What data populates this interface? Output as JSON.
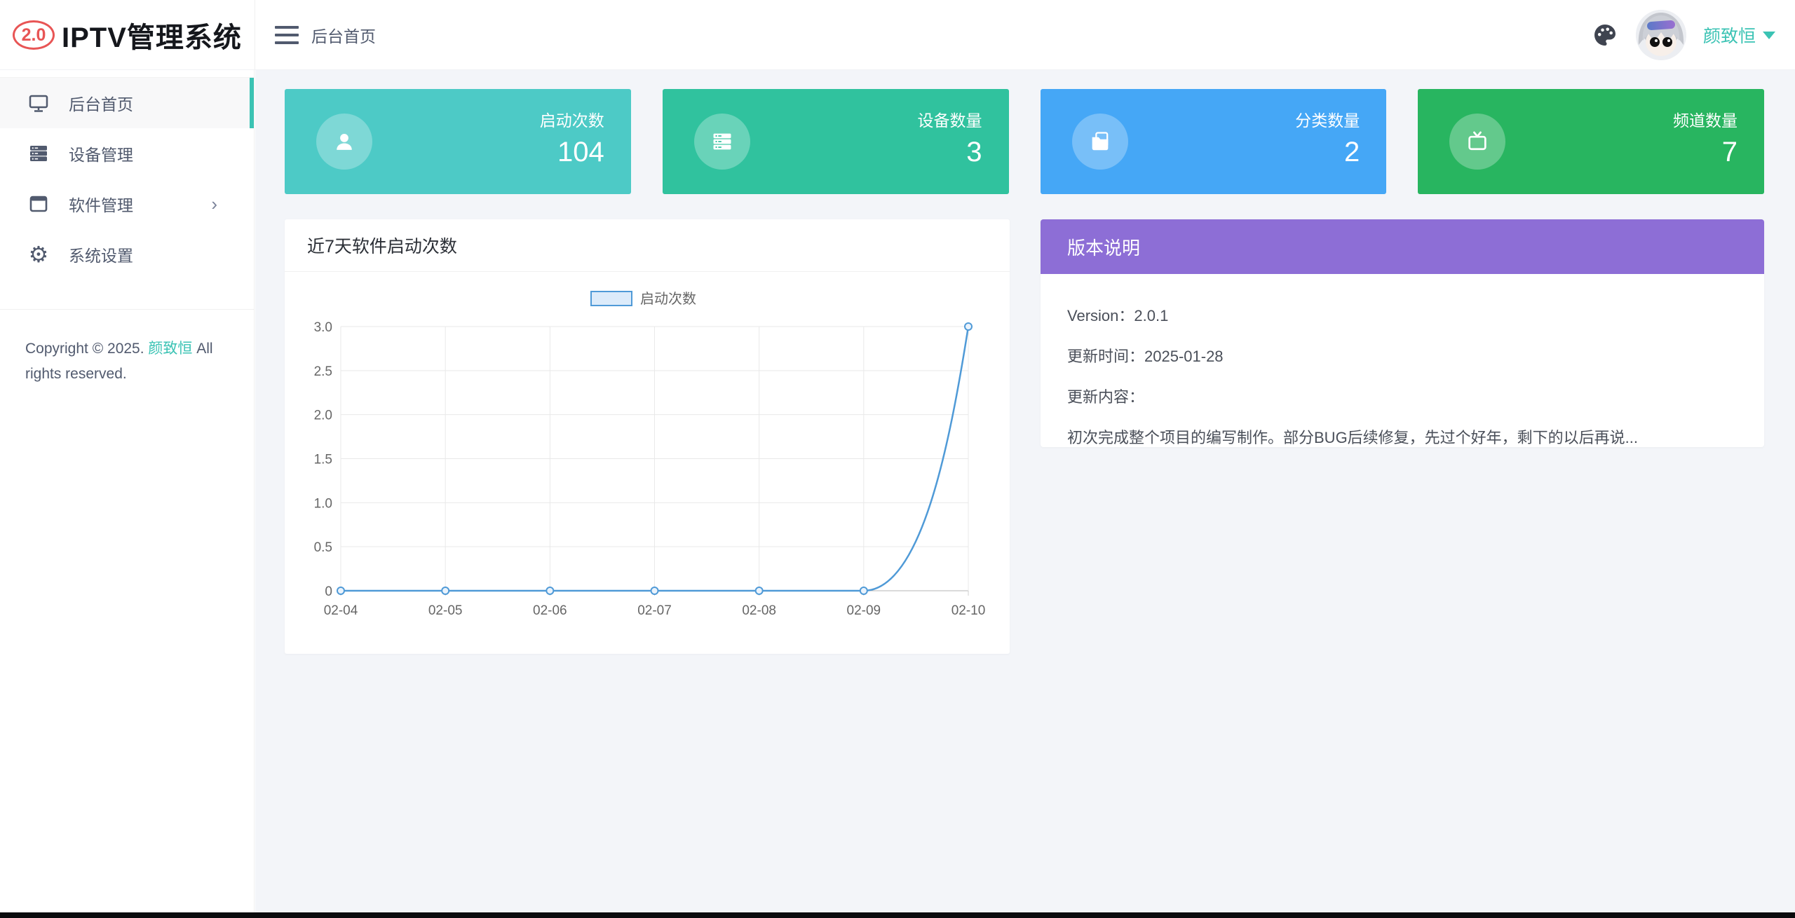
{
  "header": {
    "logo_badge": "2.0",
    "logo_title": "IPTV管理系统",
    "breadcrumb": "后台首页",
    "username": "颜致恒"
  },
  "sidebar": {
    "items": [
      {
        "label": "后台首页",
        "active": true
      },
      {
        "label": "设备管理",
        "active": false
      },
      {
        "label": "软件管理",
        "active": false,
        "chevron": "›"
      },
      {
        "label": "系统设置",
        "active": false
      }
    ],
    "copyright_prefix": "Copyright © 2025. ",
    "copyright_owner": "颜致恒",
    "copyright_suffix": " All rights reserved."
  },
  "cards": [
    {
      "label": "启动次数",
      "value": "104",
      "color": "#4dcac6"
    },
    {
      "label": "设备数量",
      "value": "3",
      "color": "#30c29e"
    },
    {
      "label": "分类数量",
      "value": "2",
      "color": "#45a7f6"
    },
    {
      "label": "频道数量",
      "value": "7",
      "color": "#28b560"
    }
  ],
  "chart_card": {
    "title": "近7天软件启动次数"
  },
  "chart_data": {
    "type": "line",
    "title": "近7天软件启动次数",
    "categories": [
      "02-04",
      "02-05",
      "02-06",
      "02-07",
      "02-08",
      "02-09",
      "02-10"
    ],
    "series": [
      {
        "name": "启动次数",
        "values": [
          0,
          0,
          0,
          0,
          0,
          0,
          3
        ]
      }
    ],
    "ylim": [
      0,
      3
    ],
    "ytick_step": 0.5,
    "grid": true,
    "legend_position": "top",
    "line_color": "#4f9ad7",
    "legend_fill": "#dcebfa",
    "marker_fill": "#eaf3fc"
  },
  "version_card": {
    "title": "版本说明",
    "header_color": "#8d6ed6",
    "version_line": "Version：2.0.1",
    "updated_line": "更新时间：2025-01-28",
    "content_label": "更新内容：",
    "content_text": "初次完成整个项目的编写制作。部分BUG后续修复，先过个好年，剩下的以后再说..."
  }
}
